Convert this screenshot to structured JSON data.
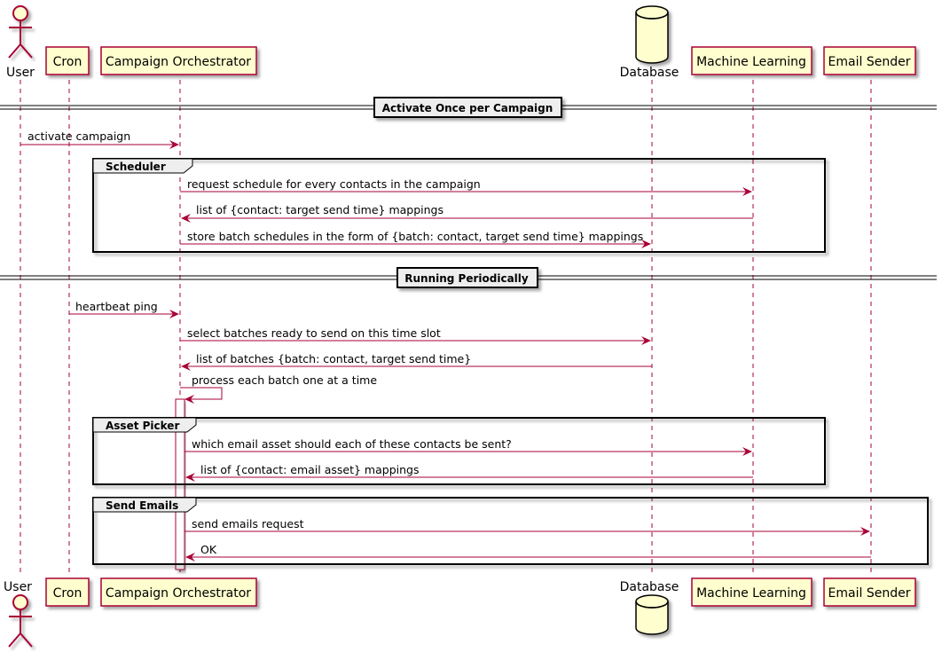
{
  "colors": {
    "line": "#A80036",
    "participant_fill": "#FEFECE",
    "frame_header_fill": "#EEEEEE",
    "divider_fill": "#EEEEEE"
  },
  "participants": [
    {
      "id": "user",
      "label": "User",
      "kind": "actor"
    },
    {
      "id": "cron",
      "label": "Cron",
      "kind": "box"
    },
    {
      "id": "orch",
      "label": "Campaign Orchestrator",
      "kind": "box"
    },
    {
      "id": "db",
      "label": "Database",
      "kind": "database"
    },
    {
      "id": "ml",
      "label": "Machine Learning",
      "kind": "box"
    },
    {
      "id": "email",
      "label": "Email Sender",
      "kind": "box"
    }
  ],
  "dividers": [
    {
      "label": "Activate Once per Campaign"
    },
    {
      "label": "Running Periodically"
    }
  ],
  "groups": [
    {
      "label": "Scheduler"
    },
    {
      "label": "Asset Picker"
    },
    {
      "label": "Send Emails"
    }
  ],
  "messages": [
    {
      "from": "user",
      "to": "orch",
      "label": "activate campaign"
    },
    {
      "from": "orch",
      "to": "ml",
      "label": "request schedule for every contacts in the campaign"
    },
    {
      "from": "ml",
      "to": "orch",
      "label": "list of {contact: target send time} mappings"
    },
    {
      "from": "orch",
      "to": "db",
      "label": "store batch schedules in the form of {batch: contact, target send time} mappings"
    },
    {
      "from": "cron",
      "to": "orch",
      "label": "heartbeat ping"
    },
    {
      "from": "orch",
      "to": "db",
      "label": "select batches ready to send on this time slot"
    },
    {
      "from": "db",
      "to": "orch",
      "label": "list of batches {batch: contact, target send time}"
    },
    {
      "from": "orch",
      "to": "orch",
      "label": "process each batch one at a time"
    },
    {
      "from": "orch",
      "to": "ml",
      "label": "which email asset should each of these contacts be sent?"
    },
    {
      "from": "ml",
      "to": "orch",
      "label": "list of {contact: email asset} mappings"
    },
    {
      "from": "orch",
      "to": "email",
      "label": "send emails request"
    },
    {
      "from": "email",
      "to": "orch",
      "label": "OK"
    }
  ]
}
